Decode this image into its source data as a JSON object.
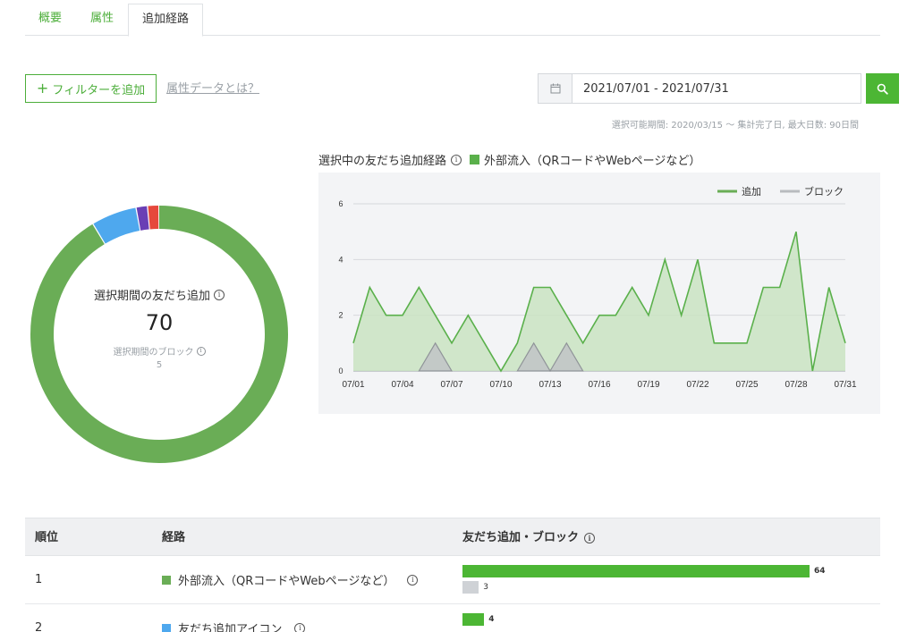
{
  "tabs": [
    {
      "label": "概要",
      "active": false
    },
    {
      "label": "属性",
      "active": false
    },
    {
      "label": "追加経路",
      "active": true
    }
  ],
  "toolbar": {
    "filter_button": "フィルターを追加",
    "attr_link": "属性データとは？",
    "date_range": "2021/07/01 - 2021/07/31",
    "period_note": "選択可能期間: 2020/03/15 〜 集計完了日, 最大日数: 90日間",
    "icons": {
      "calendar": "calendar-icon",
      "search": "search-icon"
    }
  },
  "donut": {
    "label": "選択期間の友だち追加",
    "value": "70",
    "block_label": "選択期間のブロック",
    "block_value": "5",
    "segments": [
      {
        "value": 64,
        "color": "#6aad56"
      },
      {
        "value": 4,
        "color": "#4ea8ee"
      },
      {
        "value": 1,
        "color": "#6a3fb5"
      },
      {
        "value": 1,
        "color": "#e6483c"
      }
    ]
  },
  "chart_head": {
    "title": "選択中の友だち追加経路",
    "series_label": "外部流入（QRコードやWebページなど）"
  },
  "chart_data": {
    "type": "area",
    "x": [
      "07/01",
      "07/02",
      "07/03",
      "07/04",
      "07/05",
      "07/06",
      "07/07",
      "07/08",
      "07/09",
      "07/10",
      "07/11",
      "07/12",
      "07/13",
      "07/14",
      "07/15",
      "07/16",
      "07/17",
      "07/18",
      "07/19",
      "07/20",
      "07/21",
      "07/22",
      "07/23",
      "07/24",
      "07/25",
      "07/26",
      "07/27",
      "07/28",
      "07/29",
      "07/30",
      "07/31"
    ],
    "x_ticks": [
      "07/01",
      "07/04",
      "07/07",
      "07/10",
      "07/13",
      "07/16",
      "07/19",
      "07/22",
      "07/25",
      "07/28",
      "07/31"
    ],
    "y_ticks": [
      "0",
      "2",
      "4",
      "6"
    ],
    "ylim": [
      0,
      6
    ],
    "legend": [
      {
        "name": "追加",
        "color": "#6aad56"
      },
      {
        "name": "ブロック",
        "color": "#b8bbbf"
      }
    ],
    "series": [
      {
        "name": "追加",
        "values": [
          1,
          3,
          2,
          2,
          3,
          2,
          1,
          2,
          1,
          0,
          1,
          3,
          3,
          2,
          1,
          2,
          2,
          3,
          2,
          4,
          2,
          4,
          1,
          1,
          1,
          3,
          3,
          5,
          0,
          3,
          1
        ]
      },
      {
        "name": "ブロック",
        "values": [
          0,
          0,
          0,
          0,
          0,
          1,
          0,
          0,
          0,
          0,
          0,
          1,
          0,
          1,
          0,
          0,
          0,
          0,
          0,
          0,
          0,
          0,
          0,
          0,
          0,
          0,
          0,
          0,
          0,
          0,
          0
        ]
      }
    ],
    "legend_position": "top-right",
    "grid": true
  },
  "table": {
    "headers": {
      "rank": "順位",
      "route": "経路",
      "adds": "友だち追加・ブロック"
    },
    "rows": [
      {
        "rank": "1",
        "route": "外部流入（QRコードやWebページなど）",
        "color": "#6aad56",
        "add": 64,
        "add_label": "64",
        "block": 3,
        "block_label": "3"
      },
      {
        "rank": "2",
        "route": "友だち追加アイコン",
        "color": "#4ea8ee",
        "add": 4,
        "add_label": "4",
        "block": 0,
        "block_label": ""
      }
    ],
    "bar_max": 64
  }
}
